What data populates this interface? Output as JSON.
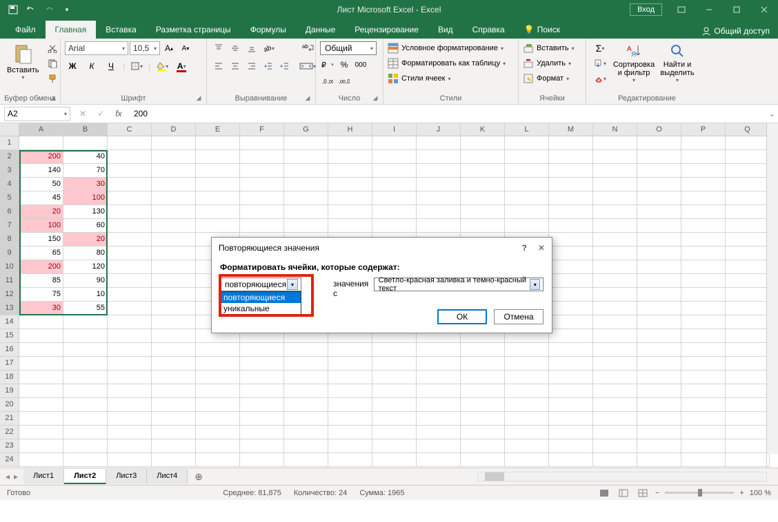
{
  "titlebar": {
    "title": "Лист Microsoft Excel  -  Excel",
    "login": "Вход"
  },
  "tabs": {
    "items": [
      "Файл",
      "Главная",
      "Вставка",
      "Разметка страницы",
      "Формулы",
      "Данные",
      "Рецензирование",
      "Вид",
      "Справка",
      "Поиск"
    ],
    "active": 1,
    "share": "Общий доступ"
  },
  "ribbon": {
    "clipboard": {
      "paste": "Вставить",
      "label": "Буфер обмена"
    },
    "font": {
      "name": "Arial",
      "size": "10,5",
      "bold": "Ж",
      "italic": "К",
      "underline": "Ч",
      "label": "Шрифт"
    },
    "alignment": {
      "label": "Выравнивание"
    },
    "number": {
      "format": "Общий",
      "label": "Число"
    },
    "styles": {
      "cond": "Условное форматирование",
      "table": "Форматировать как таблицу",
      "cell": "Стили ячеек",
      "label": "Стили"
    },
    "cells": {
      "insert": "Вставить",
      "delete": "Удалить",
      "format": "Формат",
      "label": "Ячейки"
    },
    "editing": {
      "sort": "Сортировка и фильтр",
      "find": "Найти и выделить",
      "label": "Редактирование"
    }
  },
  "formula_bar": {
    "name_box": "A2",
    "formula": "200"
  },
  "grid": {
    "columns": [
      "A",
      "B",
      "C",
      "D",
      "E",
      "F",
      "G",
      "H",
      "I",
      "J",
      "K",
      "L",
      "M",
      "N",
      "O",
      "P",
      "Q"
    ],
    "sel_cols": [
      0,
      1
    ],
    "row_count": 24,
    "sel_rows_from": 2,
    "sel_rows_to": 13,
    "data": [
      {
        "r": 2,
        "a": {
          "v": "200",
          "dup": true
        },
        "b": {
          "v": "40",
          "dup": false
        }
      },
      {
        "r": 3,
        "a": {
          "v": "140",
          "dup": false
        },
        "b": {
          "v": "70",
          "dup": false
        }
      },
      {
        "r": 4,
        "a": {
          "v": "50",
          "dup": false
        },
        "b": {
          "v": "30",
          "dup": true
        }
      },
      {
        "r": 5,
        "a": {
          "v": "45",
          "dup": false
        },
        "b": {
          "v": "100",
          "dup": true
        }
      },
      {
        "r": 6,
        "a": {
          "v": "20",
          "dup": true
        },
        "b": {
          "v": "130",
          "dup": false
        }
      },
      {
        "r": 7,
        "a": {
          "v": "100",
          "dup": true
        },
        "b": {
          "v": "60",
          "dup": false
        }
      },
      {
        "r": 8,
        "a": {
          "v": "150",
          "dup": false
        },
        "b": {
          "v": "20",
          "dup": true
        }
      },
      {
        "r": 9,
        "a": {
          "v": "65",
          "dup": false
        },
        "b": {
          "v": "80",
          "dup": false
        }
      },
      {
        "r": 10,
        "a": {
          "v": "200",
          "dup": true
        },
        "b": {
          "v": "120",
          "dup": false
        }
      },
      {
        "r": 11,
        "a": {
          "v": "85",
          "dup": false
        },
        "b": {
          "v": "90",
          "dup": false
        }
      },
      {
        "r": 12,
        "a": {
          "v": "75",
          "dup": false
        },
        "b": {
          "v": "10",
          "dup": false
        }
      },
      {
        "r": 13,
        "a": {
          "v": "30",
          "dup": true
        },
        "b": {
          "v": "55",
          "dup": false
        }
      }
    ]
  },
  "sheets": {
    "tabs": [
      "Лист1",
      "Лист2",
      "Лист3",
      "Лист4"
    ],
    "active": 1
  },
  "status": {
    "ready": "Готово",
    "avg_label": "Среднее:",
    "avg": "81,875",
    "count_label": "Количество:",
    "count": "24",
    "sum_label": "Сумма:",
    "sum": "1965",
    "zoom": "100 %"
  },
  "dialog": {
    "title": "Повторяющиеся значения",
    "subtitle": "Форматировать ячейки, которые содержат:",
    "combo1_value": "повторяющиеся",
    "combo1_options": [
      "повторяющиеся",
      "уникальные"
    ],
    "mid_text": "значения с",
    "combo2_value": "Светло-красная заливка и темно-красный текст",
    "ok": "ОК",
    "cancel": "Отмена"
  }
}
